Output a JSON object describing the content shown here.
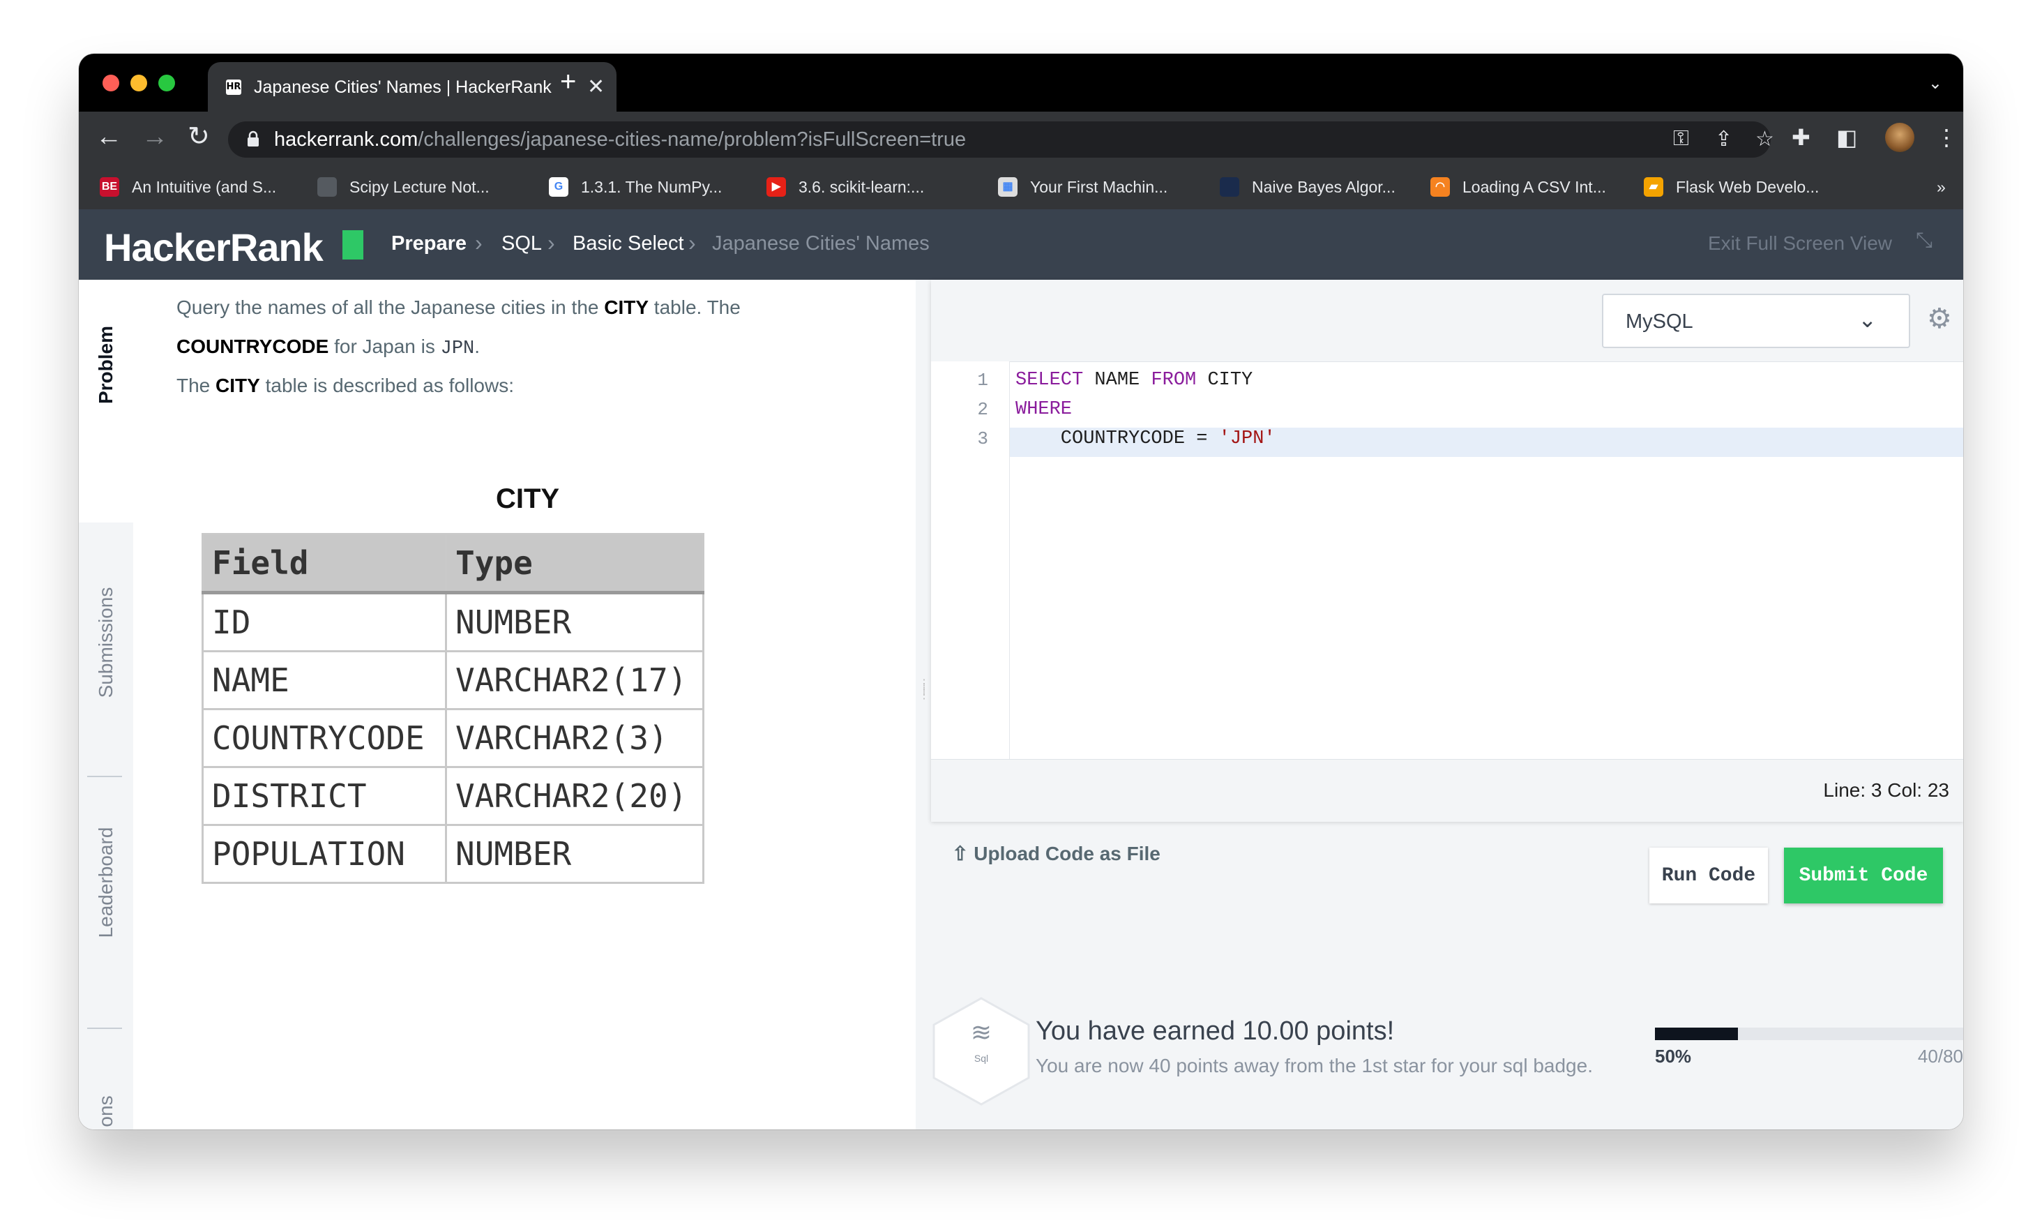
{
  "browser": {
    "tab_title": "Japanese Cities' Names | HackerRank",
    "tab_favicon": "HR",
    "url_domain": "hackerrank.com",
    "url_path": "/challenges/japanese-cities-name/problem?isFullScreen=true",
    "bookmarks": [
      {
        "label": "An Intuitive (and S...",
        "icon": "BE",
        "color": "#c8102e"
      },
      {
        "label": "Scipy Lecture Not...",
        "icon": "",
        "color": "#555a60"
      },
      {
        "label": "1.3.1. The NumPy...",
        "icon": "G",
        "color": "#ffffff"
      },
      {
        "label": "3.6. scikit-learn:...",
        "icon": "▶",
        "color": "#e62117"
      },
      {
        "label": "Your First Machin...",
        "icon": "▦",
        "color": "#dddddd"
      },
      {
        "label": "Naive Bayes Algor...",
        "icon": "",
        "color": "#1a2b4c"
      },
      {
        "label": "Loading A CSV Int...",
        "icon": "◠",
        "color": "#f58220"
      },
      {
        "label": "Flask Web Develo...",
        "icon": "▰",
        "color": "#f4a300"
      }
    ],
    "more_bookmarks": "»"
  },
  "header": {
    "logo": "HackerRank",
    "breadcrumb": [
      "Prepare",
      "SQL",
      "Basic Select",
      "Japanese Cities' Names"
    ],
    "exit_fullscreen": "Exit Full Screen View"
  },
  "side_tabs": [
    "Problem",
    "Submissions",
    "Leaderboard",
    "ons"
  ],
  "problem": {
    "line1_pre": "Query the names of all the Japanese cities in the ",
    "line1_bold": "CITY",
    "line1_post": " table. The",
    "line2_bold": "COUNTRYCODE",
    "line2_mid": " for Japan is ",
    "line2_code": "JPN",
    "line2_end": ".",
    "line3_pre": "The ",
    "line3_bold": "CITY",
    "line3_post": " table is described as follows:",
    "table_title": "CITY",
    "table_headers": [
      "Field",
      "Type"
    ],
    "table_rows": [
      [
        "ID",
        "NUMBER"
      ],
      [
        "NAME",
        "VARCHAR2(17)"
      ],
      [
        "COUNTRYCODE",
        "VARCHAR2(3)"
      ],
      [
        "DISTRICT",
        "VARCHAR2(20)"
      ],
      [
        "POPULATION",
        "NUMBER"
      ]
    ]
  },
  "editor": {
    "language": "MySQL",
    "line_numbers": [
      "1",
      "2",
      "3"
    ],
    "line1_kw1": "SELECT",
    "line1_mid": " NAME ",
    "line1_kw2": "FROM",
    "line1_end": " CITY",
    "line2_kw": "WHERE",
    "line3_indent": "    COUNTRYCODE = ",
    "line3_str": "'JPN'",
    "status": "Line: 3 Col: 23"
  },
  "actions": {
    "upload": "Upload Code as File",
    "run": "Run Code",
    "submit": "Submit Code"
  },
  "points": {
    "badge_label": "Sql",
    "earned": "You have earned 10.00 points!",
    "away": "You are now 40 points away from the 1st star for your sql badge.",
    "progress_fraction": 0.5,
    "percent_label": "50%",
    "score": "40/80"
  },
  "colors": {
    "accent_green": "#2ec866",
    "header_bg": "#39424e"
  }
}
